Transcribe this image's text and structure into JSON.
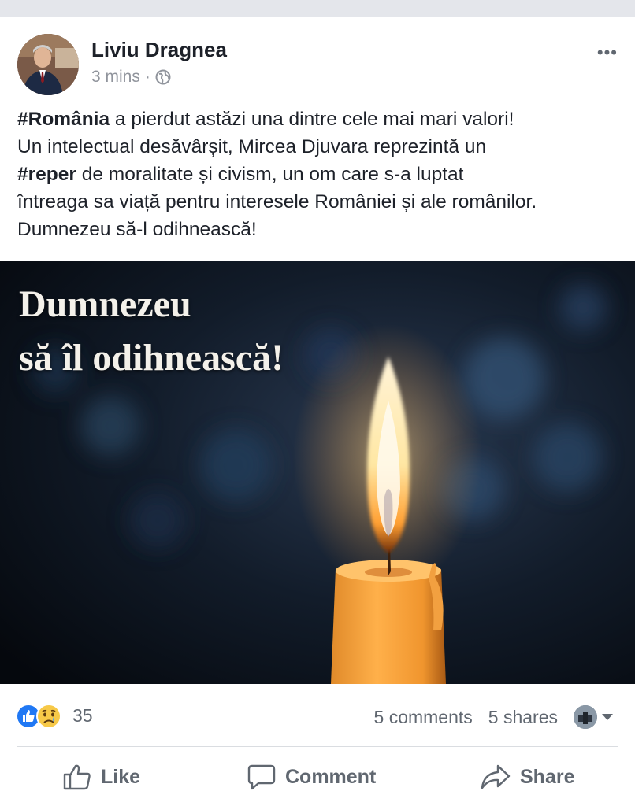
{
  "post": {
    "author": "Liviu Dragnea",
    "time": "3 mins",
    "separator": "·",
    "privacy_icon": "globe-icon",
    "more_label": "•••",
    "text": {
      "line1_hashtag": "#România",
      "line1_rest": " a pierdut astăzi una dintre cele mai mari valori!",
      "line2": "Un intelectual desăvârșit, Mircea Djuvara reprezintă un",
      "line3_hashtag": "#reper",
      "line3_rest": " de moralitate și civism, un om care s-a luptat",
      "line4": "întreaga sa viață pentru interesele României și ale românilor.",
      "line5": "Dumnezeu să-l odihnească!"
    },
    "image": {
      "caption_line1": "Dumnezeu",
      "caption_line2": "să îl odihnească!",
      "subject": "candle"
    }
  },
  "stats": {
    "reactions_count": "35",
    "reaction_icons": [
      "like-reaction-icon",
      "sad-reaction-icon"
    ],
    "comments": "5 comments",
    "shares": "5 shares"
  },
  "actions": {
    "like": "Like",
    "comment": "Comment",
    "share": "Share"
  },
  "colors": {
    "like_blue": "#2078f4",
    "sad_yellow": "#f7c948",
    "meta_gray": "#90949c",
    "action_gray": "#606770",
    "divider": "#dadde1"
  }
}
